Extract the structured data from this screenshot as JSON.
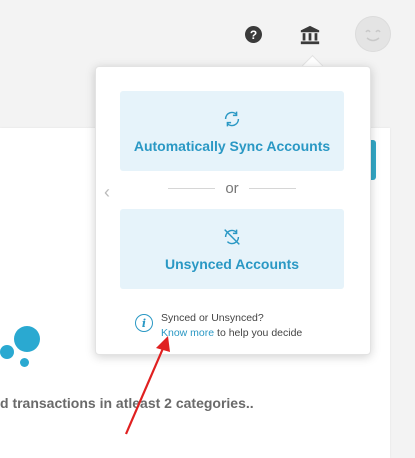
{
  "header": {
    "help_icon": "help-circle-icon",
    "bank_icon": "bank-icon",
    "avatar": "avatar"
  },
  "popover": {
    "option_sync": {
      "label": "Automatically Sync Accounts",
      "icon": "sync-icon"
    },
    "divider_text": "or",
    "option_unsynced": {
      "label": "Unsynced Accounts",
      "icon": "sync-off-icon"
    },
    "info": {
      "title": "Synced or Unsynced?",
      "link_text": "Know more",
      "suffix": " to help you decide"
    }
  },
  "main": {
    "bottom_text": "d transactions in atleast 2 categories.."
  },
  "colors": {
    "accent": "#2a98c4",
    "option_bg": "#e6f3fa",
    "annotation": "#e02020"
  }
}
